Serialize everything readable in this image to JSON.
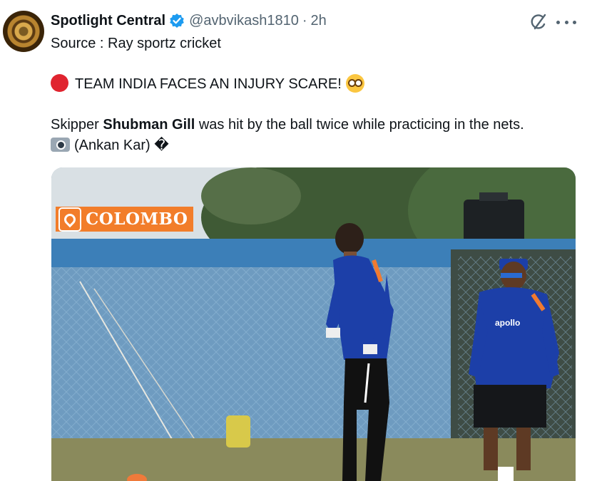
{
  "tweet": {
    "display_name": "Spotlight Central",
    "handle": "@avbvikash1810",
    "separator": "·",
    "time": "2h",
    "line_source": "Source : Ray sportz cricket",
    "headline": "TEAM INDIA FACES AN INJURY SCARE!",
    "body_prefix": "Skipper",
    "body_name": "Shubman Gill",
    "body_suffix": "was hit by the ball twice while practicing in the nets.",
    "credit": "(Ankan Kar)",
    "replacement_char": "�"
  },
  "media": {
    "location_label": "COLOMBO",
    "shirt_sponsor": "apollo"
  },
  "icons": {
    "verified": "verified-badge-icon",
    "grok": "grok-icon",
    "more": "more-icon",
    "red_circle": "red-circle-emoji",
    "flushed": "flushed-face-emoji",
    "camera": "camera-flash-emoji",
    "pin": "map-pin-icon"
  },
  "colors": {
    "verified": "#1d9bf0",
    "secondary_text": "#536471",
    "badge": "#f27d2a",
    "jersey": "#1c3fa8"
  }
}
